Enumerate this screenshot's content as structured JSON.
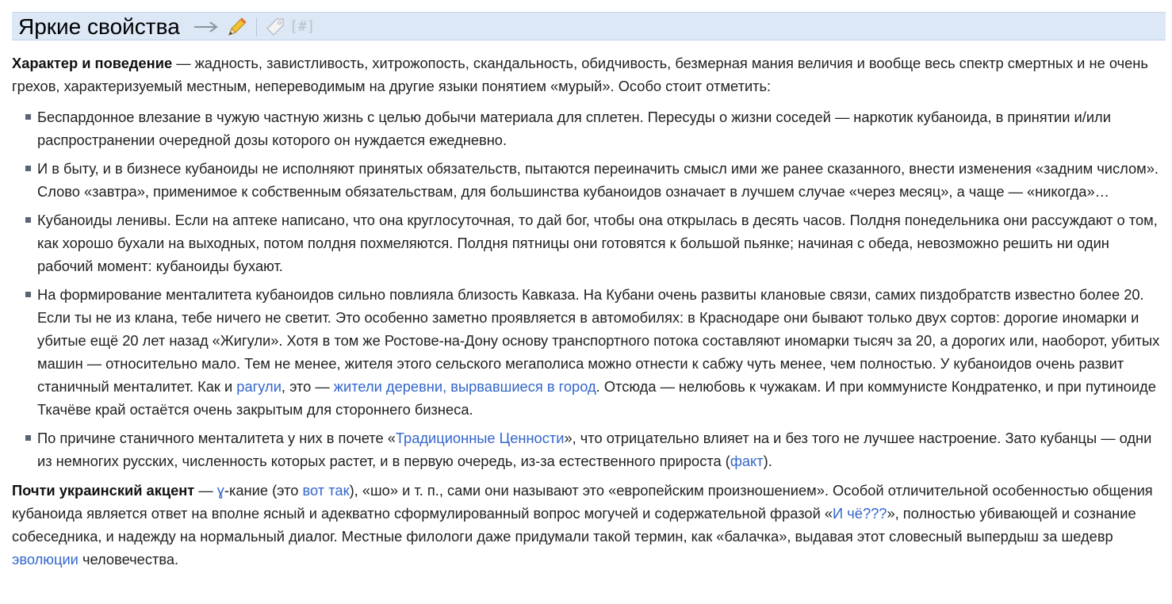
{
  "section": {
    "title": "Яркие свойства",
    "tools": {
      "arrow_icon": "arrow-right-icon",
      "edit_icon": "pencil-icon",
      "tag_icon": "tag-icon",
      "anchor_label": "[#]"
    }
  },
  "para1": {
    "bold": "Характер и поведение",
    "text": " — жадность, завистливость, хитрожопость, скандальность, обидчивость, безмерная мания величия и вообще весь спектр смертных и не очень грехов, характеризуемый местным, непереводимым на другие языки понятием «мурый». Особо стоит отметить:"
  },
  "list": {
    "item1": "Беспардонное влезание в чужую частную жизнь с целью добычи материала для сплетен. Пересуды о жизни соседей — наркотик кубаноида, в принятии и/или распространении очередной дозы которого он нуждается ежедневно.",
    "item2": "И в быту, и в бизнесе кубаноиды не исполняют принятых обязательств, пытаются переиначить смысл ими же ранее сказанного, внести изменения «задним числом». Слово «завтра», применимое к собственным обязательствам, для большинства кубаноидов означает в лучшем случае «через месяц», а чаще — «никогда»…",
    "item3": "Кубаноиды ленивы. Если на аптеке написано, что она круглосуточная, то дай бог, чтобы она открылась в десять часов. Полдня понедельника они рассуждают о том, как хорошо бухали на выходных, потом полдня похмеляются. Полдня пятницы они готовятся к большой пьянке; начиная с обеда, невозможно решить ни один рабочий момент: кубаноиды бухают.",
    "item4": {
      "t1": "На формирование менталитета кубаноидов сильно повлияла близость Кавказа. На Кубани очень развиты клановые связи, самих пиздобратств известно более 20. Если ты не из клана, тебе ничего не светит. Это особенно заметно проявляется в автомобилях: в Краснодаре они бывают только двух сортов: дорогие иномарки и убитые ещё 20 лет назад «Жигули». Хотя в том же Ростове-на-Дону основу транспортного потока составляют иномарки тысяч за 20, а дорогих или, наоборот, убитых машин — относительно мало. Тем не менее, жителя этого сельского мегаполиса можно отнести к сабжу чуть менее, чем полностью. У кубаноидов очень развит станичный менталитет. Как и ",
      "link1": "рагули",
      "t2": ", это — ",
      "link2": "жители деревни, вырвавшиеся в город",
      "t3": ". Отсюда — нелюбовь к чужакам. И при коммунисте Кондратенко, и при путиноиде Ткачёве край остаётся очень закрытым для стороннего бизнеса."
    },
    "item5": {
      "t1": "По причине станичного менталитета у них в почете «",
      "link1": "Традиционные Ценности",
      "t2": "», что отрицательно влияет на и без того не лучшее настроение. Зато кубанцы — одни из немногих русских, численность которых растет, и в первую очередь, из-за естественного прироста (",
      "link2": "факт",
      "t3": ")."
    }
  },
  "para2": {
    "bold": "Почти украинский акцент",
    "t1": " — ",
    "link1": "ɣ",
    "t2": "-кание (это ",
    "link2": "вот так",
    "t3": "), «шо» и т. п., сами они называют это «европейским произношением». Особой отличительной особенностью общения кубаноида является ответ на вполне ясный и адекватно сформулированный вопрос могучей и содержательной фразой «",
    "link3": "И чё???",
    "t4": "», полностью убивающей и сознание собеседника, и надежду на нормальный диалог. Местные филологи даже придумали такой термин, как «балачка», выдавая этот словесный выпердыш за шедевр ",
    "link4": "эволюции",
    "t5": " человечества."
  }
}
